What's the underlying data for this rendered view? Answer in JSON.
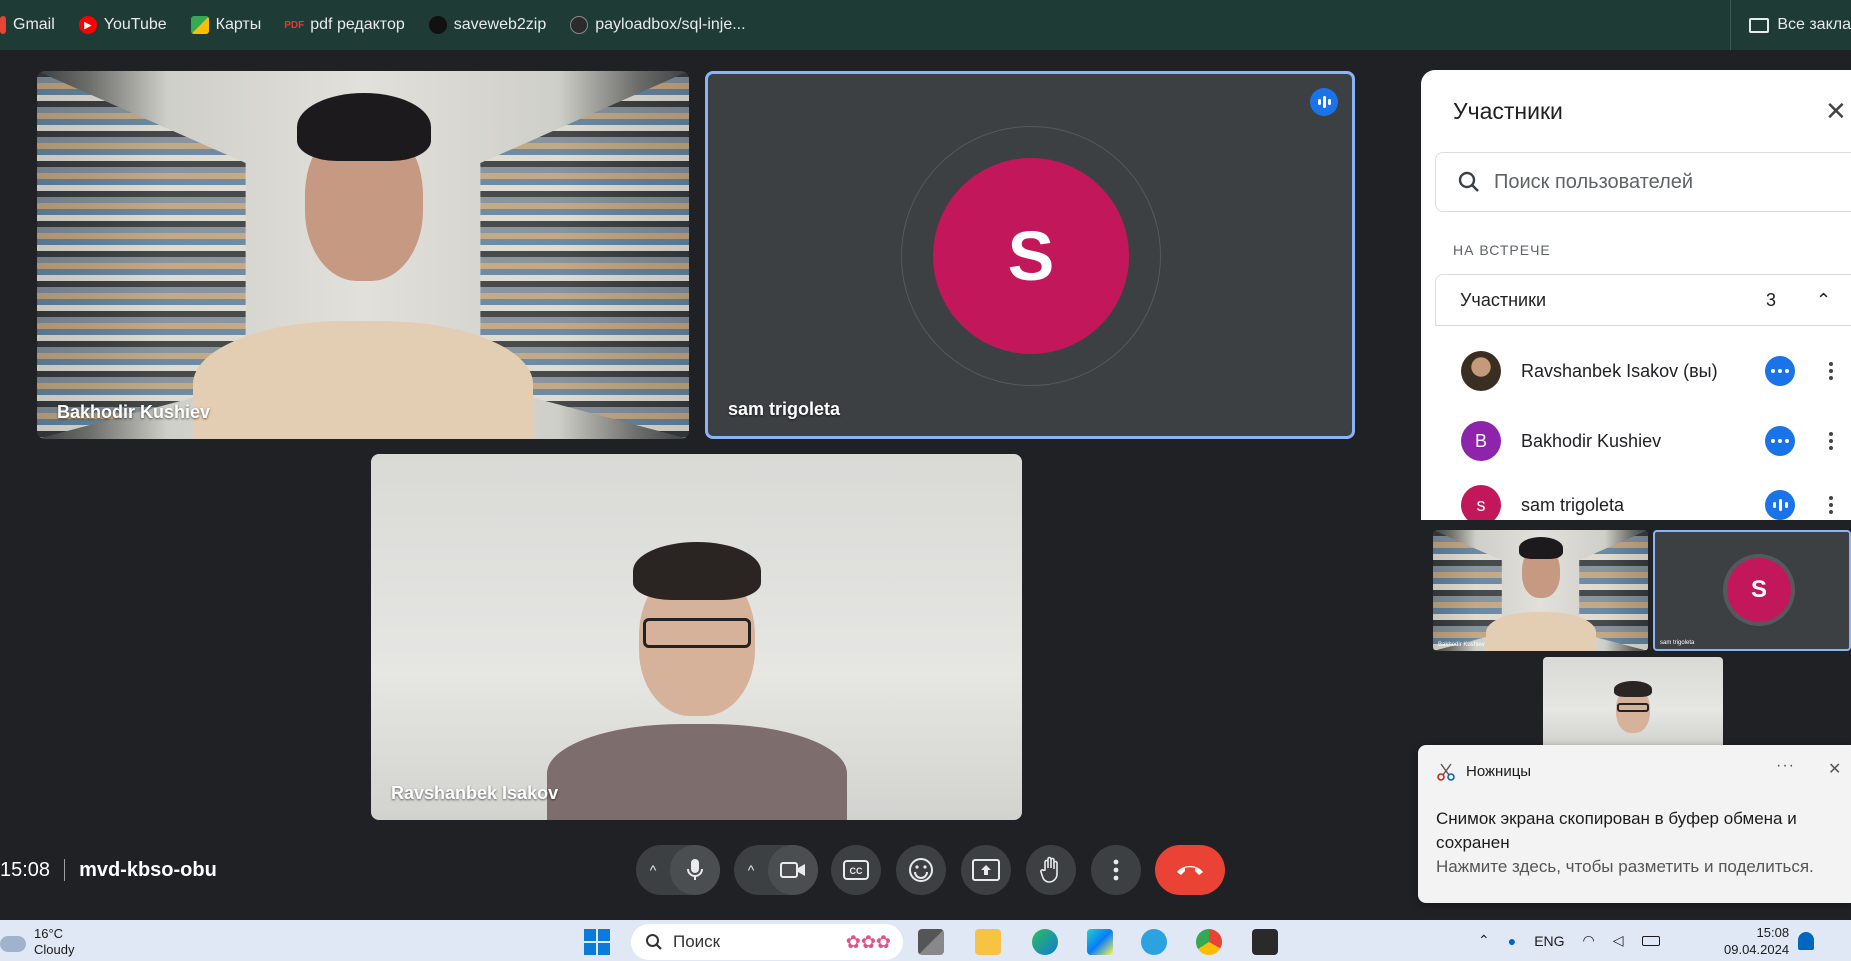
{
  "bookmarks": {
    "items": [
      {
        "label": "Gmail",
        "icon": "gmail-icon"
      },
      {
        "label": "YouTube",
        "icon": "youtube-icon"
      },
      {
        "label": "Карты",
        "icon": "maps-icon"
      },
      {
        "label": "pdf редактор",
        "icon": "pdf-icon"
      },
      {
        "label": "saveweb2zip",
        "icon": "saveweb2zip-icon"
      },
      {
        "label": "payloadbox/sql-inje...",
        "icon": "github-icon"
      }
    ],
    "all_label": "Все закла"
  },
  "tiles": {
    "bakhodir": {
      "name": "Bakhodir Kushiev"
    },
    "sam": {
      "name": "sam trigoleta",
      "initial": "S"
    },
    "ravshanbek": {
      "name": "Ravshanbek Isakov"
    }
  },
  "meeting": {
    "time": "15:08",
    "code": "mvd-kbso-obu"
  },
  "controls": {
    "mic": "mic-icon",
    "camera": "camera-icon",
    "captions": "captions-icon",
    "emoji": "emoji-icon",
    "present": "present-icon",
    "hand": "raise-hand-icon",
    "more": "more-icon",
    "end": "end-call-icon",
    "end_color": "#ea4335"
  },
  "panel": {
    "title": "Участники",
    "search_placeholder": "Поиск пользователей",
    "section": "НА ВСТРЕЧЕ",
    "group_label": "Участники",
    "group_count": "3",
    "participants": [
      {
        "name": "Ravshanbek Isakov (вы)",
        "initial": "",
        "color": "#4a3a2a"
      },
      {
        "name": "Bakhodir Kushiev",
        "initial": "B",
        "color": "#8e24aa"
      },
      {
        "name": "sam trigoleta",
        "initial": "s",
        "color": "#c2185b"
      }
    ]
  },
  "thumbs": {
    "bakhodir": "Bakhodir Kushiev",
    "sam": "sam trigoleta",
    "sam_initial": "S"
  },
  "toast": {
    "app": "Ножницы",
    "more": "···",
    "message": "Снимок экрана скопирован в буфер обмена и сохранен",
    "sub": "Нажмите здесь, чтобы разметить и поделиться."
  },
  "taskbar": {
    "weather_temp": "16°C",
    "weather_desc": "Cloudy",
    "search_placeholder": "Поиск",
    "lang": "ENG",
    "time": "15:08",
    "date": "09.04.2024"
  },
  "colors": {
    "accent": "#1a73e8",
    "active_border": "#8ab4f8",
    "avatar_pink": "#c2185b"
  }
}
